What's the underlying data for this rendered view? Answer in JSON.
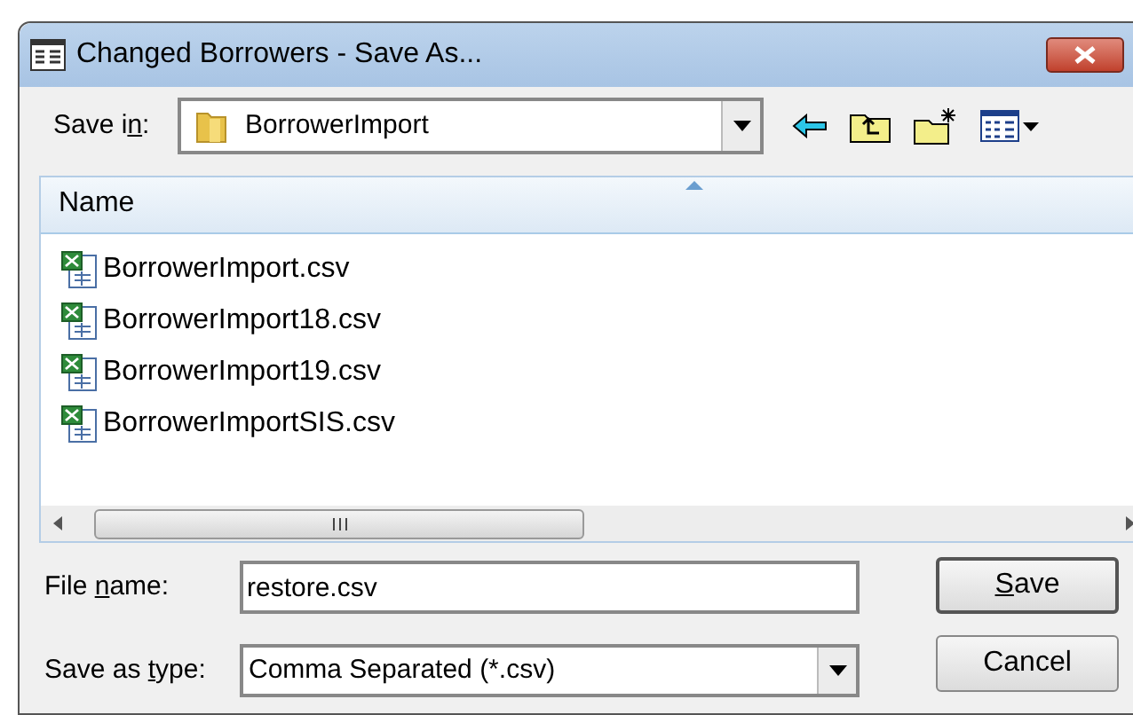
{
  "window": {
    "title": "Changed Borrowers - Save As..."
  },
  "save_in": {
    "label": {
      "before": "Save i",
      "mnemonic": "n",
      "after": ":"
    },
    "value": "BorrowerImport"
  },
  "list": {
    "columns": [
      {
        "label": "Name",
        "sorted": true
      }
    ],
    "files": [
      {
        "name": "BorrowerImport.csv",
        "selected": false
      },
      {
        "name": "BorrowerImport18.csv",
        "selected": false
      },
      {
        "name": "BorrowerImport19.csv",
        "selected": false
      },
      {
        "name": "BorrowerImportSIS.csv",
        "selected": false
      }
    ]
  },
  "file_name": {
    "label": {
      "before": "File ",
      "mnemonic": "n",
      "after": "ame:"
    },
    "value": "restore.csv"
  },
  "save_as_type": {
    "label": {
      "before": "Save as ",
      "mnemonic": "t",
      "after": "ype:"
    },
    "value": "Comma Separated (*.csv)"
  },
  "buttons": [
    {
      "mnemonic": "S",
      "after": "ave",
      "default": true
    },
    {
      "before": "Cancel",
      "default": false
    }
  ]
}
